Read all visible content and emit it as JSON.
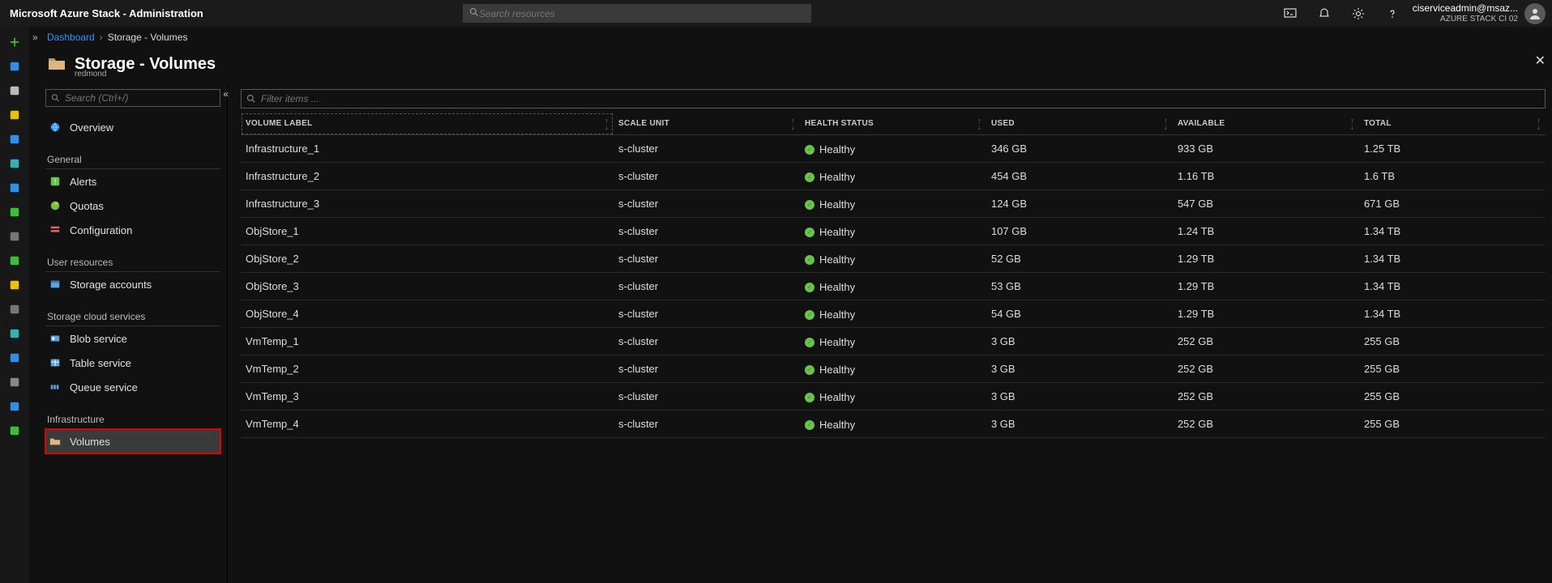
{
  "header": {
    "product_title": "Microsoft Azure Stack - Administration",
    "search_placeholder": "Search resources",
    "account_email": "ciserviceadmin@msaz...",
    "account_sub": "AZURE STACK CI 02"
  },
  "breadcrumb": {
    "root": "Dashboard",
    "current": "Storage - Volumes"
  },
  "page": {
    "title": "Storage - Volumes",
    "subtitle": "redmond"
  },
  "sidenav": {
    "search_placeholder": "Search (Ctrl+/)",
    "overview": "Overview",
    "groups": [
      {
        "label": "General",
        "items": [
          {
            "icon": "alerts",
            "label": "Alerts"
          },
          {
            "icon": "quotas",
            "label": "Quotas"
          },
          {
            "icon": "config",
            "label": "Configuration"
          }
        ]
      },
      {
        "label": "User resources",
        "items": [
          {
            "icon": "storage",
            "label": "Storage accounts"
          }
        ]
      },
      {
        "label": "Storage cloud services",
        "items": [
          {
            "icon": "blob",
            "label": "Blob service"
          },
          {
            "icon": "table",
            "label": "Table service"
          },
          {
            "icon": "queue",
            "label": "Queue service"
          }
        ]
      },
      {
        "label": "Infrastructure",
        "items": [
          {
            "icon": "folder",
            "label": "Volumes",
            "selected": true
          }
        ]
      }
    ]
  },
  "main": {
    "filter_placeholder": "Filter items ...",
    "columns": {
      "volume_label": "Volume Label",
      "scale_unit": "Scale Unit",
      "health_status": "Health Status",
      "used": "Used",
      "available": "Available",
      "total": "Total"
    },
    "rows": [
      {
        "label": "Infrastructure_1",
        "scale": "s-cluster",
        "health": "Healthy",
        "used": "346 GB",
        "available": "933 GB",
        "total": "1.25 TB"
      },
      {
        "label": "Infrastructure_2",
        "scale": "s-cluster",
        "health": "Healthy",
        "used": "454 GB",
        "available": "1.16 TB",
        "total": "1.6 TB"
      },
      {
        "label": "Infrastructure_3",
        "scale": "s-cluster",
        "health": "Healthy",
        "used": "124 GB",
        "available": "547 GB",
        "total": "671 GB"
      },
      {
        "label": "ObjStore_1",
        "scale": "s-cluster",
        "health": "Healthy",
        "used": "107 GB",
        "available": "1.24 TB",
        "total": "1.34 TB"
      },
      {
        "label": "ObjStore_2",
        "scale": "s-cluster",
        "health": "Healthy",
        "used": "52 GB",
        "available": "1.29 TB",
        "total": "1.34 TB"
      },
      {
        "label": "ObjStore_3",
        "scale": "s-cluster",
        "health": "Healthy",
        "used": "53 GB",
        "available": "1.29 TB",
        "total": "1.34 TB"
      },
      {
        "label": "ObjStore_4",
        "scale": "s-cluster",
        "health": "Healthy",
        "used": "54 GB",
        "available": "1.29 TB",
        "total": "1.34 TB"
      },
      {
        "label": "VmTemp_1",
        "scale": "s-cluster",
        "health": "Healthy",
        "used": "3 GB",
        "available": "252 GB",
        "total": "255 GB"
      },
      {
        "label": "VmTemp_2",
        "scale": "s-cluster",
        "health": "Healthy",
        "used": "3 GB",
        "available": "252 GB",
        "total": "255 GB"
      },
      {
        "label": "VmTemp_3",
        "scale": "s-cluster",
        "health": "Healthy",
        "used": "3 GB",
        "available": "252 GB",
        "total": "255 GB"
      },
      {
        "label": "VmTemp_4",
        "scale": "s-cluster",
        "health": "Healthy",
        "used": "3 GB",
        "available": "252 GB",
        "total": "255 GB"
      }
    ]
  },
  "rail_colors": [
    "#38c138",
    "#2e8eea",
    "#bbbbbb",
    "#f0c000",
    "#2e8eea",
    "#34b1b8",
    "#2e8eea",
    "#38c138",
    "#777777",
    "#38c138",
    "#f0c000",
    "#777777",
    "#34b1b8",
    "#2e8eea",
    "#888888",
    "#2e8eea",
    "#38c138"
  ]
}
